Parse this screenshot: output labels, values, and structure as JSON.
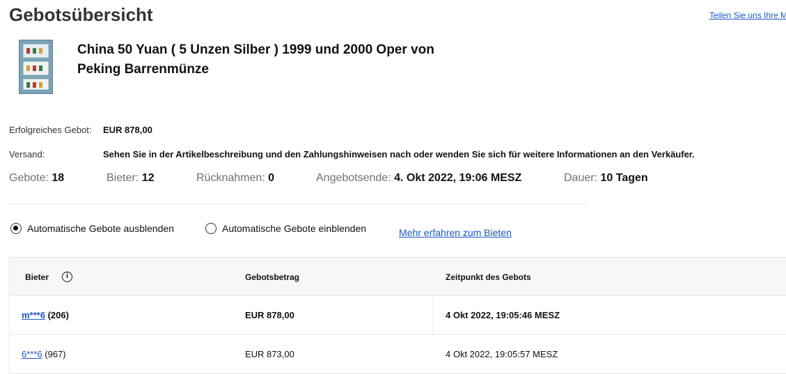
{
  "header": {
    "title": "Gebotsübersicht",
    "share_link": "Teilen Sie uns Ihre M"
  },
  "item": {
    "title": "China 50 Yuan ( 5 Unzen Silber ) 1999 und 2000 Oper von Peking Barrenmünze"
  },
  "details": {
    "winning_bid_label": "Erfolgreiches Gebot:",
    "winning_bid_value": "EUR 878,00",
    "shipping_label": "Versand:",
    "shipping_value": "Sehen Sie in der Artikelbeschreibung und den Zahlungshinweisen nach oder wenden Sie sich für weitere Informationen an den Verkäufer."
  },
  "stats": {
    "bids_label": "Gebote:",
    "bids_value": "18",
    "bidders_label": "Bieter:",
    "bidders_value": "12",
    "retractions_label": "Rücknahmen:",
    "retractions_value": "0",
    "end_label": "Angebotsende:",
    "end_value": "4. Okt 2022, 19:06 MESZ",
    "duration_label": "Dauer:",
    "duration_value": "10 Tagen"
  },
  "options": {
    "hide_auto_label": "Automatische Gebote ausblenden",
    "show_auto_label": "Automatische Gebote einblenden",
    "selected": "hide",
    "learn_more": "Mehr erfahren zum Bieten"
  },
  "table": {
    "columns": [
      "Bieter",
      "Gebotsbetrag",
      "Zeitpunkt des Gebots"
    ],
    "rows": [
      {
        "bidder": "m***6",
        "feedback": "(206)",
        "amount": "EUR 878,00",
        "time": "4 Okt 2022, 19:05:46 MESZ"
      },
      {
        "bidder": "6***6",
        "feedback": "(967)",
        "amount": "EUR 873,00",
        "time": "4 Okt 2022, 19:05:57 MESZ"
      }
    ]
  },
  "colors": {
    "link": "#1a56c6",
    "table_header_bg": "#f7f7f7",
    "divider": "#e5e5e5"
  }
}
